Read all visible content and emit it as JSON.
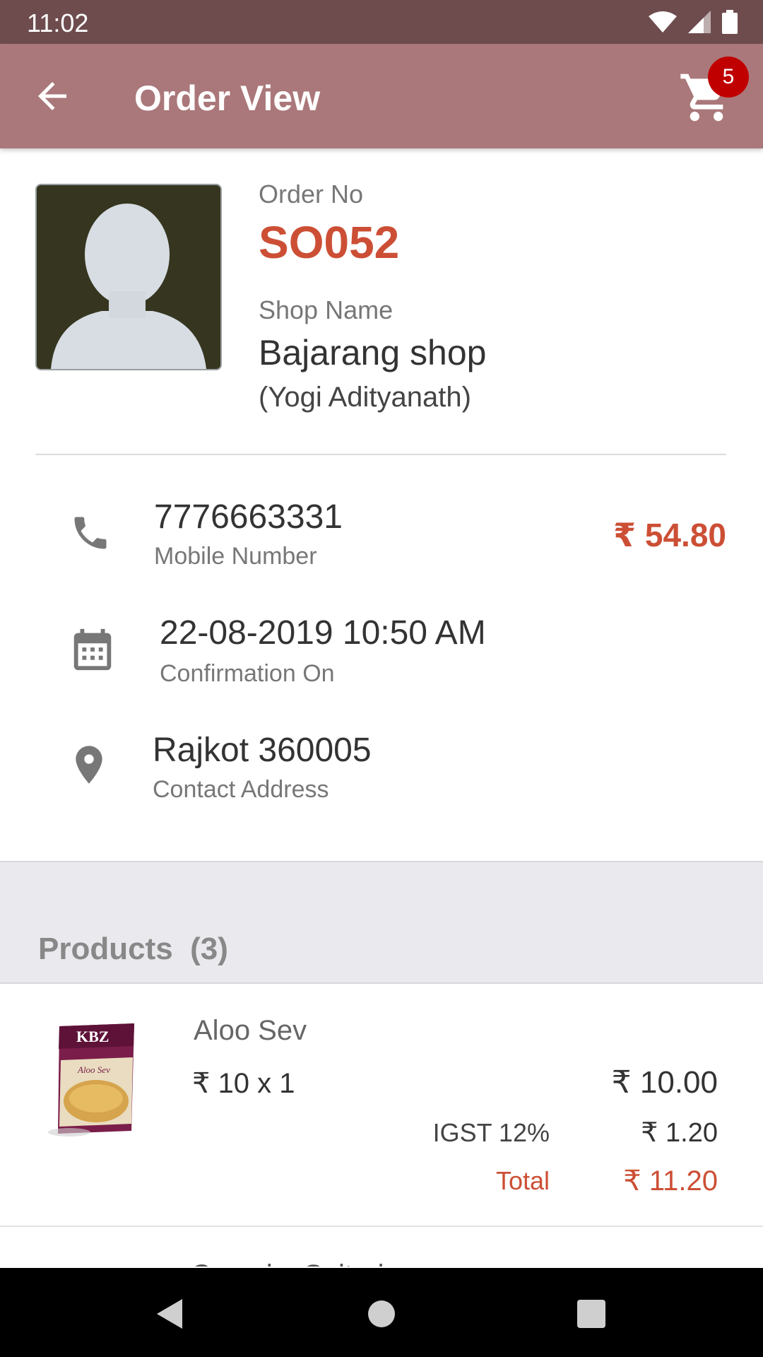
{
  "status_bar": {
    "time": "11:02"
  },
  "app_bar": {
    "title": "Order View",
    "cart_count": "5"
  },
  "order": {
    "order_no_label": "Order No",
    "order_no": "SO052",
    "shop_label": "Shop Name",
    "shop_name": "Bajarang shop",
    "owner": "(Yogi Adityanath)",
    "amount": "₹ 54.80",
    "mobile": {
      "value": "7776663331",
      "label": "Mobile Number"
    },
    "confirmation": {
      "value": "22-08-2019 10:50 AM",
      "label": "Confirmation On"
    },
    "address": {
      "value": "Rajkot 360005",
      "label": "Contact Address"
    }
  },
  "products": {
    "title": "Products",
    "count": "(3)",
    "items": [
      {
        "name": "Aloo Sev",
        "price_qty": "₹ 10 x 1",
        "subtotal": "₹ 10.00",
        "tax_label": "IGST 12%",
        "tax_value": "₹ 1.20",
        "total_label": "Total",
        "total_value": "₹ 11.20",
        "image_icon": "snack-pack-image"
      }
    ],
    "next_item_partial": "Crunchy Salted Chips"
  },
  "colors": {
    "accent": "#cc4f35",
    "app_bar": "#aa787a",
    "status_bar": "#6e4c4e",
    "badge": "#c00000"
  }
}
